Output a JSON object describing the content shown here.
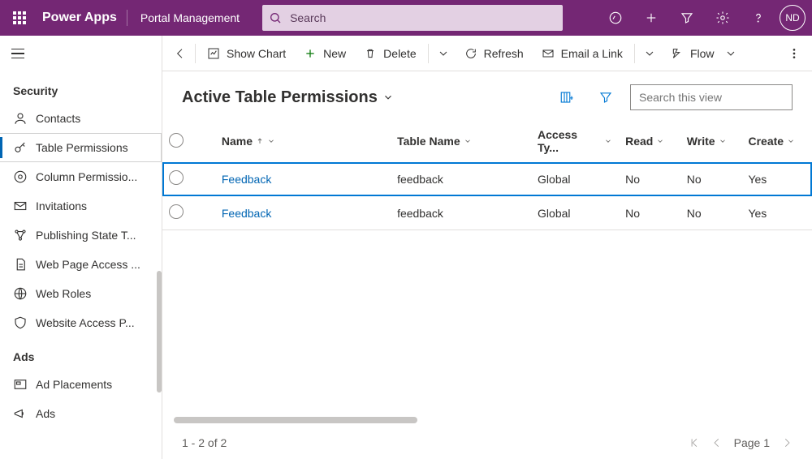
{
  "header": {
    "brand": "Power Apps",
    "app_name": "Portal Management",
    "search_placeholder": "Search",
    "avatar_initials": "ND"
  },
  "sidebar": {
    "groups": [
      {
        "title": "Security",
        "items": [
          {
            "icon": "contact",
            "label": "Contacts"
          },
          {
            "icon": "key",
            "label": "Table Permissions",
            "selected": true
          },
          {
            "icon": "settings-cog",
            "label": "Column Permissio..."
          },
          {
            "icon": "mail",
            "label": "Invitations"
          },
          {
            "icon": "state",
            "label": "Publishing State T..."
          },
          {
            "icon": "page",
            "label": "Web Page Access ..."
          },
          {
            "icon": "globe",
            "label": "Web Roles"
          },
          {
            "icon": "shield",
            "label": "Website Access P..."
          }
        ]
      },
      {
        "title": "Ads",
        "items": [
          {
            "icon": "placement",
            "label": "Ad Placements"
          },
          {
            "icon": "megaphone",
            "label": "Ads"
          }
        ]
      }
    ]
  },
  "commands": {
    "show_chart": "Show Chart",
    "new": "New",
    "delete": "Delete",
    "refresh": "Refresh",
    "email": "Email a Link",
    "flow": "Flow"
  },
  "view": {
    "title": "Active Table Permissions",
    "search_placeholder": "Search this view"
  },
  "grid": {
    "columns": [
      "Name",
      "Table Name",
      "Access Ty...",
      "Read",
      "Write",
      "Create"
    ],
    "sort_col": 0,
    "rows": [
      {
        "selected": true,
        "name": "Feedback",
        "table": "feedback",
        "access": "Global",
        "read": "No",
        "write": "No",
        "create": "Yes"
      },
      {
        "selected": false,
        "name": "Feedback",
        "table": "feedback",
        "access": "Global",
        "read": "No",
        "write": "No",
        "create": "Yes"
      }
    ],
    "footer_count": "1 - 2 of 2",
    "page_label": "Page 1"
  }
}
